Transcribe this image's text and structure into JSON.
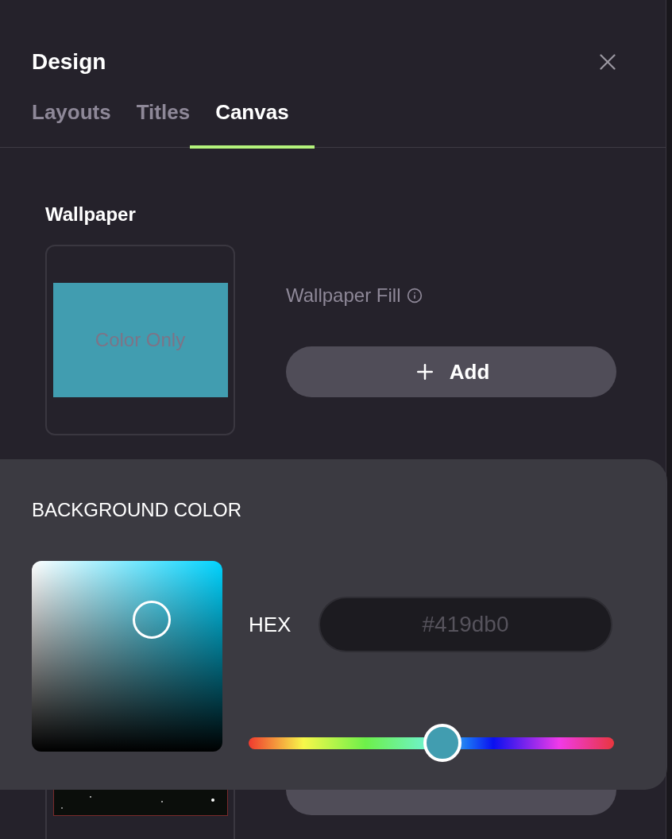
{
  "panel": {
    "title": "Design"
  },
  "tabs": [
    {
      "label": "Layouts",
      "selected": false
    },
    {
      "label": "Titles",
      "selected": false
    },
    {
      "label": "Canvas",
      "selected": true
    }
  ],
  "wallpaper": {
    "heading": "Wallpaper",
    "preview_label": "Color Only",
    "fill_label": "Wallpaper Fill",
    "add_button": "Add"
  },
  "color_popover": {
    "title": "BACKGROUND COLOR",
    "hex_label": "HEX",
    "hex_value": "#419db0",
    "hue": {
      "level": 0.53
    }
  }
}
